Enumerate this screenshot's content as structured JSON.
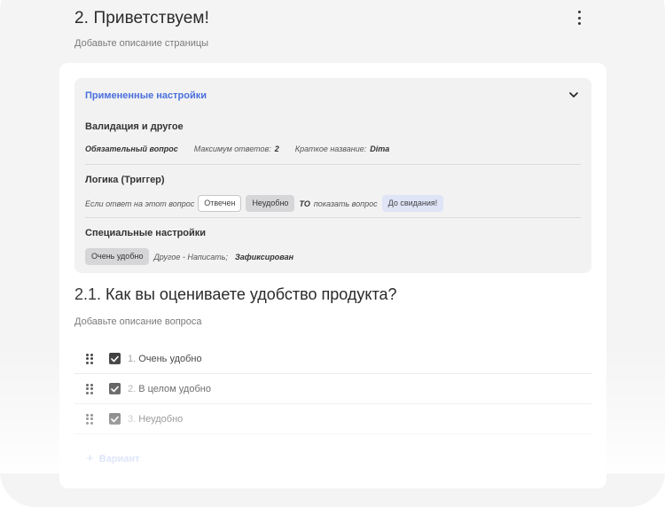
{
  "page": {
    "number": "2.",
    "title": "Приветствуем!",
    "description_placeholder": "Добавьте описание страницы"
  },
  "settings": {
    "title": "Примененные настройки",
    "validation": {
      "heading": "Валидация и другое",
      "required": "Обязательный вопрос",
      "max_answers_label": "Максимум ответов:",
      "max_answers_value": "2",
      "short_name_label": "Краткое название:",
      "short_name_value": "Dima"
    },
    "logic": {
      "heading": "Логика (Триггер)",
      "if_text": "Если ответ на этот вопрос",
      "chip_condition": "Отвечен",
      "chip_answer": "Неудобно",
      "then_keyword": "ТО",
      "then_text": "показать вопрос",
      "chip_target": "До свидания!"
    },
    "special": {
      "heading": "Специальные настройки",
      "chip_option": "Очень удобно",
      "other_text": "Другое - Написать;",
      "fixed_text": "Зафиксирован"
    }
  },
  "question": {
    "number": "2.1.",
    "title": "Как вы оцениваете удобство продукта?",
    "description_placeholder": "Добавьте описание вопроса",
    "options": [
      {
        "num": "1.",
        "label": "Очень удобно"
      },
      {
        "num": "2.",
        "label": "В целом удобно"
      },
      {
        "num": "3.",
        "label": "Неудобно"
      }
    ],
    "add_option_label": "Вариант"
  },
  "icons": {
    "menu": "kebab-menu-icon",
    "collapse": "chevron-down-icon",
    "drag": "drag-handle-icon",
    "check": "checkbox-checked-icon",
    "add": "plus-icon"
  },
  "colors": {
    "accent": "#4a6fdc",
    "background": "#f4f4f5",
    "card": "#ffffff"
  }
}
